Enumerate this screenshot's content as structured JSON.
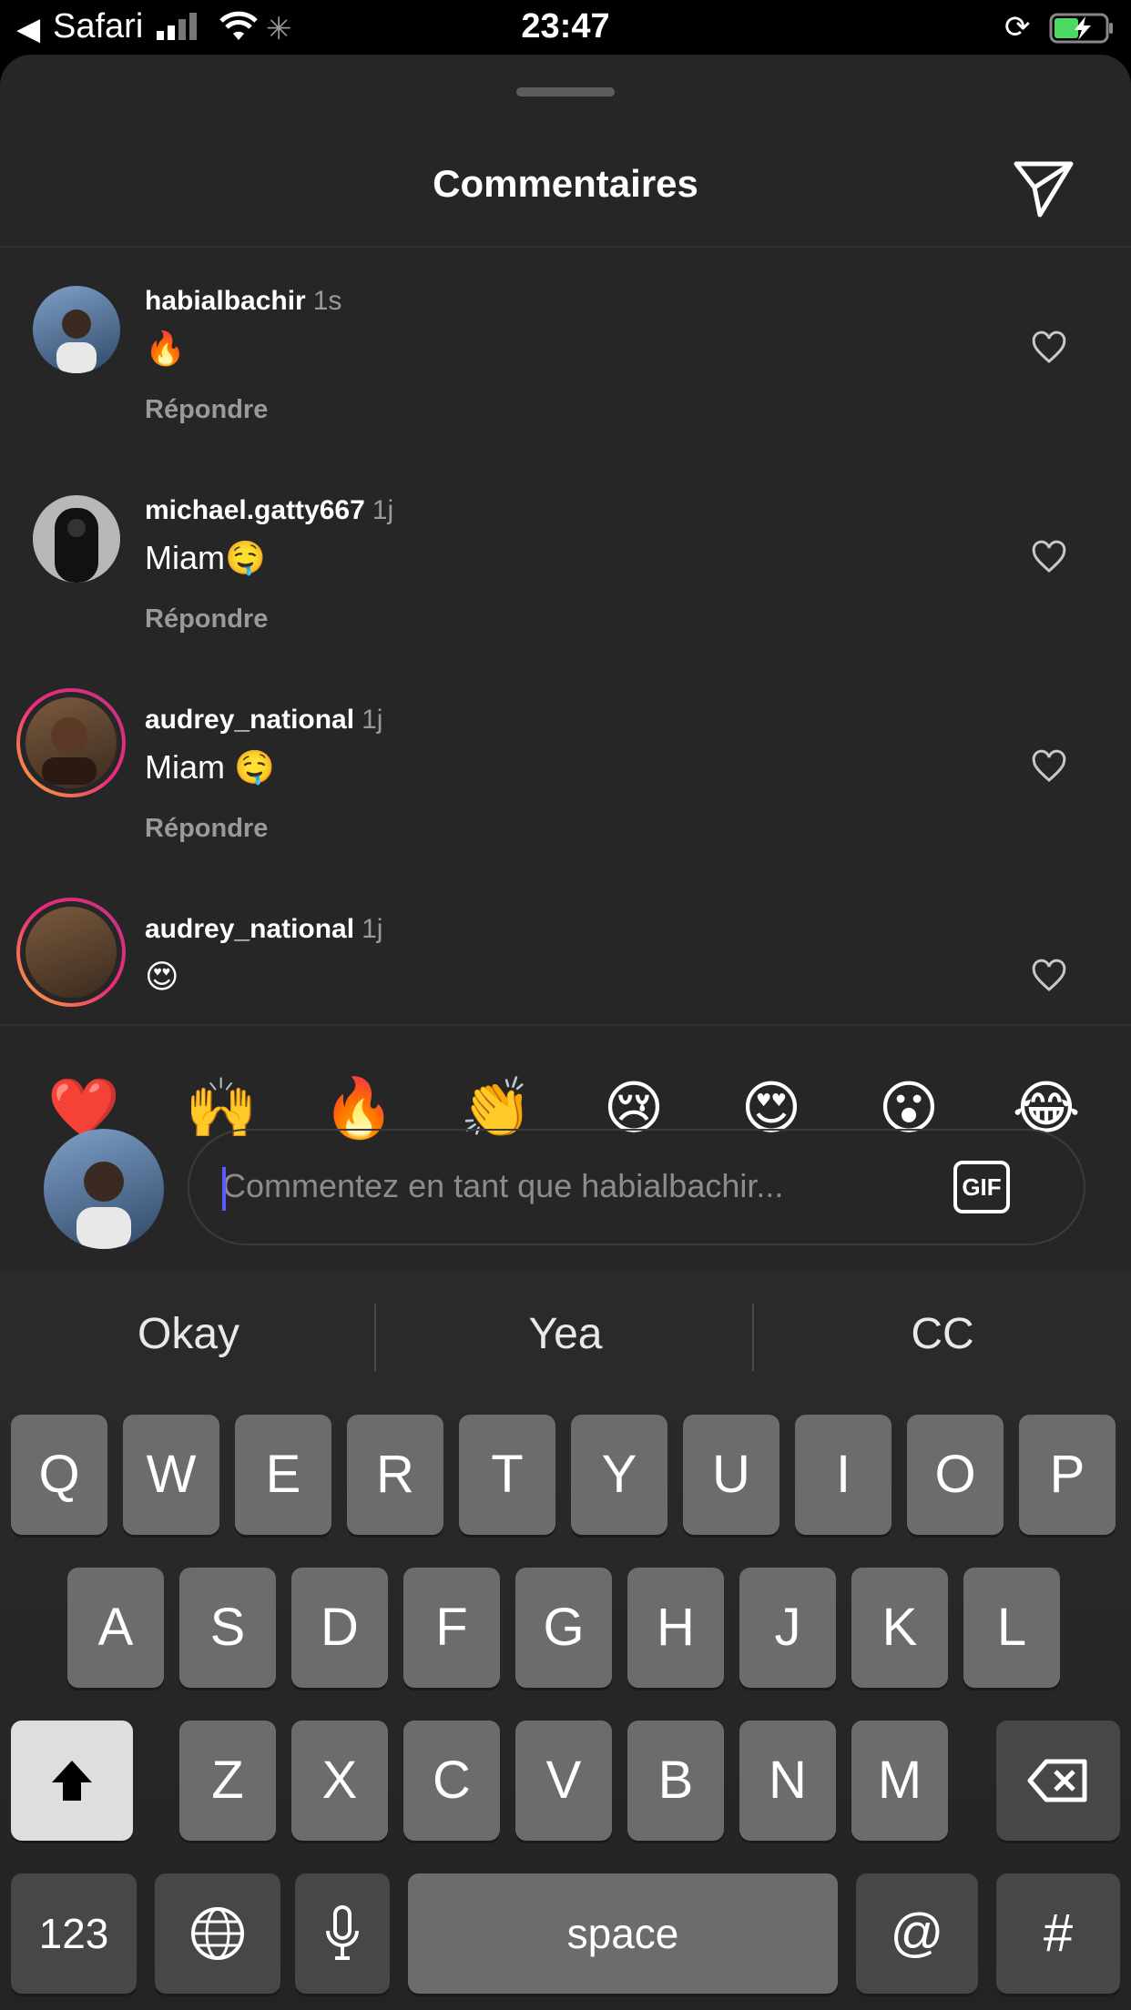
{
  "status_bar": {
    "back_label": "◀",
    "app_name": "Safari",
    "time": "23:47"
  },
  "sheet": {
    "title": "Commentaires",
    "reply_label": "Répondre"
  },
  "comments": [
    {
      "username": "habialbachir",
      "time": "1s",
      "text": "🔥"
    },
    {
      "username": "michael.gatty667",
      "time": "1j",
      "text": "Miam🤤"
    },
    {
      "username": "audrey_national",
      "time": "1j",
      "text": "Miam 🤤"
    },
    {
      "username": "audrey_national",
      "time": "1j",
      "text": "😍"
    }
  ],
  "quick_reactions": [
    "❤️",
    "🙌",
    "🔥",
    "👏",
    "😢",
    "😍",
    "😮",
    "😂"
  ],
  "composer": {
    "placeholder": "Commentez en tant que habialbachir...",
    "gif_label": "GIF"
  },
  "keyboard": {
    "suggestions": [
      "Okay",
      "Yea",
      "CC"
    ],
    "row1": [
      "Q",
      "W",
      "E",
      "R",
      "T",
      "Y",
      "U",
      "I",
      "O",
      "P"
    ],
    "row2": [
      "A",
      "S",
      "D",
      "F",
      "G",
      "H",
      "J",
      "K",
      "L"
    ],
    "row3": [
      "Z",
      "X",
      "C",
      "V",
      "B",
      "N",
      "M"
    ],
    "numbers_label": "123",
    "space_label": "space",
    "at_label": "@",
    "hash_label": "#"
  },
  "colors": {
    "sheet_bg": "#262626",
    "caret": "#5b59ff",
    "key": "#6c6c6c",
    "mod_key": "#474747"
  }
}
